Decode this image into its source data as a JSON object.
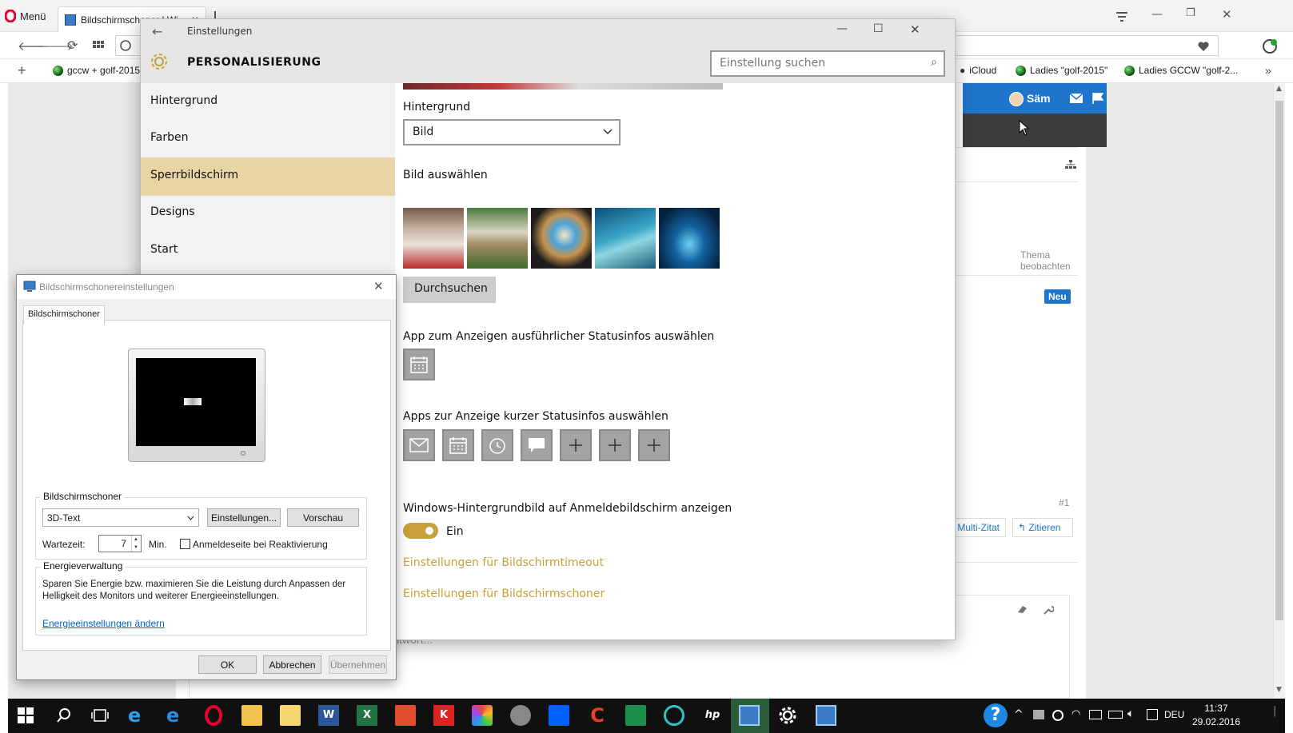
{
  "browser": {
    "menu_label": "Menü",
    "tab_title": "Bildschirmschoner | Wi...",
    "bookmarks": [
      "gccw + golf-2015",
      "iCloud",
      "Ladies \"golf-2015\"",
      "Ladies GCCW \"golf-2..."
    ],
    "user_name": "Säm",
    "thema_beobachten": "Thema beobachten",
    "neu_badge": "Neu",
    "post_number": "#1",
    "multi_zitat": "+ Multi-Zitat",
    "zitieren": "Zitieren",
    "antwort_placeholder": "Antwort..."
  },
  "settings": {
    "title": "Einstellungen",
    "heading": "PERSONALISIERUNG",
    "search_placeholder": "Einstellung suchen",
    "nav": [
      "Hintergrund",
      "Farben",
      "Sperrbildschirm",
      "Designs",
      "Start"
    ],
    "active_nav": "Sperrbildschirm",
    "content": {
      "hintergrund_label": "Hintergrund",
      "hintergrund_value": "Bild",
      "bild_auswaehlen": "Bild auswählen",
      "durchsuchen": "Durchsuchen",
      "app_detail_label": "App zum Anzeigen ausführlicher Statusinfos auswählen",
      "apps_quick_label": "Apps zur Anzeige kurzer Statusinfos auswählen",
      "windows_bg_label": "Windows-Hintergrundbild auf Anmeldebildschirm anzeigen",
      "toggle_state": "Ein",
      "link_timeout": "Einstellungen für Bildschirmtimeout",
      "link_screensaver": "Einstellungen für Bildschirmschoner"
    }
  },
  "screensaver": {
    "title": "Bildschirmschonereinstellungen",
    "tab": "Bildschirmschoner",
    "group_label": "Bildschirmschoner",
    "selected": "3D-Text",
    "einstellungen_btn": "Einstellungen...",
    "vorschau_btn": "Vorschau",
    "wartezeit_label": "Wartezeit:",
    "wartezeit_value": "7",
    "min_label": "Min.",
    "anmeldeseite_label": "Anmeldeseite bei Reaktivierung",
    "energie_label": "Energieverwaltung",
    "energie_text": "Sparen Sie Energie bzw. maximieren Sie die Leistung durch Anpassen der Helligkeit des Monitors und weiterer Energieeinstellungen.",
    "energie_link": "Energieeinstellungen ändern",
    "ok": "OK",
    "abbrechen": "Abbrechen",
    "uebernehmen": "Übernehmen"
  },
  "taskbar": {
    "language": "DEU",
    "time": "11:37",
    "date": "29.02.2016"
  },
  "colors": {
    "accent": "#c9a13a",
    "nav_active": "#e8d5a3",
    "forum_blue": "#1f75cc"
  }
}
